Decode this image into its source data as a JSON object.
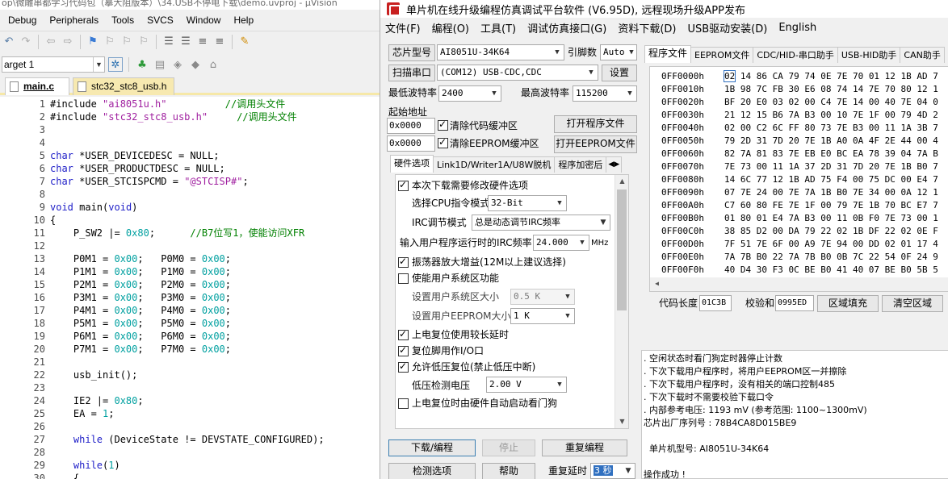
{
  "ide": {
    "window_title": "op\\微雕串都学习代码包（摹大阻版本）\\34.USB不停电下载\\demo.uvproj - µVision",
    "menu": [
      "Debug",
      "Peripherals",
      "Tools",
      "SVCS",
      "Window",
      "Help"
    ],
    "target": "arget 1",
    "tabs": [
      "main.c",
      "stc32_stc8_usb.h"
    ],
    "code_lines": [
      {
        "n": "1",
        "text": "#include \"ai8051u.h\"          //调用头文件"
      },
      {
        "n": "2",
        "text": "#include \"stc32_stc8_usb.h\"     //调用头文件"
      },
      {
        "n": "3",
        "text": ""
      },
      {
        "n": "4",
        "text": ""
      },
      {
        "n": "5",
        "text": "char *USER_DEVICEDESC = NULL;"
      },
      {
        "n": "6",
        "text": "char *USER_PRODUCTDESC = NULL;"
      },
      {
        "n": "7",
        "text": "char *USER_STCISPCMD = \"@STCISP#\";"
      },
      {
        "n": "8",
        "text": ""
      },
      {
        "n": "9",
        "text": "void main(void)"
      },
      {
        "n": "10",
        "text": "{"
      },
      {
        "n": "11",
        "text": "    P_SW2 |= 0x80;      //B7位写1，使能访问XFR"
      },
      {
        "n": "12",
        "text": ""
      },
      {
        "n": "13",
        "text": "    P0M1 = 0x00;   P0M0 = 0x00;"
      },
      {
        "n": "14",
        "text": "    P1M1 = 0x00;   P1M0 = 0x00;"
      },
      {
        "n": "15",
        "text": "    P2M1 = 0x00;   P2M0 = 0x00;"
      },
      {
        "n": "16",
        "text": "    P3M1 = 0x00;   P3M0 = 0x00;"
      },
      {
        "n": "17",
        "text": "    P4M1 = 0x00;   P4M0 = 0x00;"
      },
      {
        "n": "18",
        "text": "    P5M1 = 0x00;   P5M0 = 0x00;"
      },
      {
        "n": "19",
        "text": "    P6M1 = 0x00;   P6M0 = 0x00;"
      },
      {
        "n": "20",
        "text": "    P7M1 = 0x00;   P7M0 = 0x00;"
      },
      {
        "n": "21",
        "text": ""
      },
      {
        "n": "22",
        "text": "    usb_init();"
      },
      {
        "n": "23",
        "text": ""
      },
      {
        "n": "24",
        "text": "    IE2 |= 0x80;"
      },
      {
        "n": "25",
        "text": "    EA = 1;"
      },
      {
        "n": "26",
        "text": ""
      },
      {
        "n": "27",
        "text": "    while (DeviceState != DEVSTATE_CONFIGURED);"
      },
      {
        "n": "28",
        "text": ""
      },
      {
        "n": "29",
        "text": "    while(1)"
      },
      {
        "n": "30",
        "text": "    {"
      }
    ]
  },
  "stc": {
    "title": "单片机在线升级编程仿真调试平台软件 (V6.95D), 远程现场升级APP发布",
    "menu": [
      "文件(F)",
      "编程(O)",
      "工具(T)",
      "调试仿真接口(G)",
      "资料下载(D)",
      "USB驱动安装(D)",
      "English"
    ],
    "chip_model_label": "芯片型号",
    "chip_model": "AI8051U-34K64",
    "pin_count_label": "引脚数",
    "pin_count": "Auto",
    "scan_port_btn": "扫描串口",
    "port": "(COM12) USB-CDC,CDC",
    "settings_btn": "设置",
    "min_baud_label": "最低波特率",
    "min_baud": "2400",
    "max_baud_label": "最高波特率",
    "max_baud": "115200",
    "start_addr_label": "起始地址",
    "addr1": "0x0000",
    "clear_code_buf": "清除代码缓冲区",
    "open_prog_btn": "打开程序文件",
    "addr2": "0x0000",
    "clear_eeprom_buf": "清除EEPROM缓冲区",
    "open_eeprom_btn": "打开EEPROM文件",
    "left_tabs": [
      "硬件选项",
      "Link1D/Writer1A/U8W脱机",
      "程序加密后"
    ],
    "hw": {
      "modify_hw": "本次下载需要修改硬件选项",
      "cpu_mode_label": "选择CPU指令模式",
      "cpu_mode": "32-Bit",
      "irc_mode_label": "IRC调节模式",
      "irc_mode": "总是动态调节IRC频率",
      "irc_freq_label": "输入用户程序运行时的IRC频率",
      "irc_freq": "24.000",
      "mhz": "MHz",
      "osc_gain": "振荡器放大增益(12M以上建议选择)",
      "sys_area": "使能用户系统区功能",
      "sys_area_size_label": "设置用户系统区大小",
      "sys_area_size": "0.5 K",
      "eeprom_size_label": "设置用户EEPROM大小",
      "eeprom_size": "1  K",
      "long_reset": "上电复位使用较长延时",
      "reset_pin": "复位脚用作I/O口",
      "lvr": "允许低压复位(禁止低压中断)",
      "lvd_label": "低压检测电压",
      "lvd": "2.00 V",
      "wdt": "上电复位时由硬件自动启动看门狗"
    },
    "download_btn": "下载/编程",
    "stop_btn": "停止",
    "reprogram_btn": "重复编程",
    "detect_btn": "检测选项",
    "help_btn": "帮助",
    "repeat_delay_label": "重复延时",
    "repeat_delay": "3 秒",
    "right_tabs": [
      "程序文件",
      "EEPROM文件",
      "CDC/HID-串口助手",
      "USB-HID助手",
      "CAN助手"
    ],
    "hex_rows": [
      {
        "addr": "0FF0000h",
        "bytes": "02 14 86 CA 79 74 0E 7E 70 01 12 1B AD 7"
      },
      {
        "addr": "0FF0010h",
        "bytes": "1B 98 7C FB 30 E6 08 74 14 7E 70 80 12 1"
      },
      {
        "addr": "0FF0020h",
        "bytes": "BF 20 E0 03 02 00 C4 7E 14 00 40 7E 04 0"
      },
      {
        "addr": "0FF0030h",
        "bytes": "21 12 15 B6 7A B3 00 10 7E 1F 00 79 4D 2"
      },
      {
        "addr": "0FF0040h",
        "bytes": "02 00 C2 6C FF 80 73 7E B3 00 11 1A 3B 7"
      },
      {
        "addr": "0FF0050h",
        "bytes": "79 2D 31 7D 20 7E 1B A0 0A 4F 2E 44 00 4"
      },
      {
        "addr": "0FF0060h",
        "bytes": "82 7A 81 83 7E EB E0 BC EA 78 39 04 7A B"
      },
      {
        "addr": "0FF0070h",
        "bytes": "7E 73 00 11 1A 37 2D 31 7D 20 7E 1B B0 7"
      },
      {
        "addr": "0FF0080h",
        "bytes": "14 6C 77 12 1B AD 75 F4 00 75 DC 00 E4 7"
      },
      {
        "addr": "0FF0090h",
        "bytes": "07 7E 24 00 7E 7A 1B B0 7E 34 00 0A 12 1"
      },
      {
        "addr": "0FF00A0h",
        "bytes": "C7 60 80 FE 7E 1F 00 79 7E 1B 70 BC E7 7"
      },
      {
        "addr": "0FF00B0h",
        "bytes": "01 80 01 E4 7A B3 00 11 0B F0 7E 73 00 1"
      },
      {
        "addr": "0FF00C0h",
        "bytes": "38 85 D2 00 DA 79 22 02 1B DF 22 02 0E F"
      },
      {
        "addr": "0FF00D0h",
        "bytes": "7F 51 7E 6F 00 A9 7E 94 00 DD 02 01 17 4"
      },
      {
        "addr": "0FF00E0h",
        "bytes": "7A 7B B0 22 7A 7B B0 0B 7C 22 54 0F 24 9"
      },
      {
        "addr": "0FF00F0h",
        "bytes": "40 D4 30 F3 0C BE B0 41 40 07 BE B0 5B 5"
      }
    ],
    "code_len_label": "代码长度",
    "code_len": "01C3B",
    "checksum_label": "校验和",
    "checksum": "0995ED",
    "fill_btn": "区域填充",
    "clear_btn": "清空区域",
    "log": [
      ". 空闲状态时看门狗定时器停止计数",
      ". 下次下载用户程序时，将用户EEPROM区一并擦除",
      ". 下次下载用户程序时，没有相关的端口控制485",
      ". 下次下载时不需要校验下载口令",
      ". 内部参考电压: 1193 mV (参考范围: 1100~1300mV)",
      "芯片出厂序列号 : 78B4CA8D015BE9",
      "",
      "  单片机型号: AI8051U-34K64",
      "",
      "操作成功 !"
    ]
  }
}
